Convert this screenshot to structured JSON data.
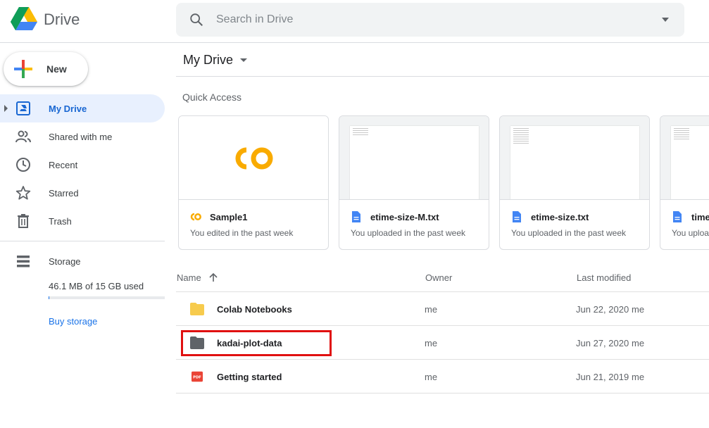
{
  "app": {
    "title": "Drive"
  },
  "search": {
    "placeholder": "Search in Drive"
  },
  "sidebar": {
    "new_label": "New",
    "items": [
      {
        "label": "My Drive",
        "icon": "my-drive-icon",
        "active": true
      },
      {
        "label": "Shared with me",
        "icon": "shared-icon"
      },
      {
        "label": "Recent",
        "icon": "clock-icon"
      },
      {
        "label": "Starred",
        "icon": "star-icon"
      },
      {
        "label": "Trash",
        "icon": "trash-icon"
      }
    ],
    "storage": {
      "label": "Storage",
      "used": "46.1 MB of 15 GB used",
      "fraction": 0.003,
      "buy": "Buy storage"
    }
  },
  "main": {
    "title": "My Drive",
    "quick_access": {
      "title": "Quick Access",
      "cards": [
        {
          "name": "Sample1",
          "subtitle": "You edited in the past week",
          "icon": "colab-icon"
        },
        {
          "name": "etime-size-M.txt",
          "subtitle": "You uploaded in the past week",
          "icon": "doc-icon"
        },
        {
          "name": "etime-size.txt",
          "subtitle": "You uploaded in the past week",
          "icon": "doc-icon"
        },
        {
          "name": "time",
          "subtitle": "You uploa",
          "icon": "doc-icon"
        }
      ]
    },
    "table": {
      "headers": {
        "name": "Name",
        "owner": "Owner",
        "modified": "Last modified"
      },
      "rows": [
        {
          "name": "Colab Notebooks",
          "owner": "me",
          "date": "Jun 22, 2020",
          "by": "me",
          "icon": "folder-yellow-icon"
        },
        {
          "name": "kadai-plot-data",
          "owner": "me",
          "date": "Jun 27, 2020",
          "by": "me",
          "icon": "folder-gray-icon"
        },
        {
          "name": "Getting started",
          "owner": "me",
          "date": "Jun 21, 2019",
          "by": "me",
          "icon": "pdf-icon"
        }
      ]
    }
  },
  "colors": {
    "accent": "#1a73e8",
    "active_bg": "#e8f0fe",
    "highlight": "#e01010",
    "folder_yellow": "#f7cb4d",
    "folder_gray": "#5f6368",
    "pdf_red": "#ea4335"
  }
}
